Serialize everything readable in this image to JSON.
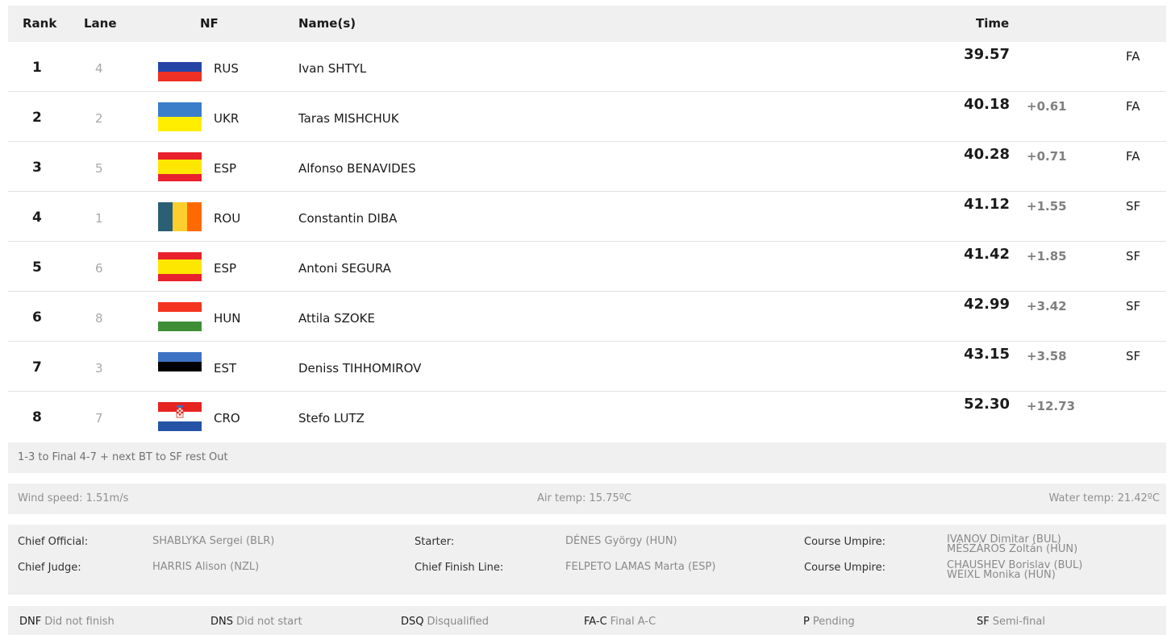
{
  "table": {
    "headers": {
      "rank": "Rank",
      "lane": "Lane",
      "nf": "NF",
      "names": "Name(s)",
      "time": "Time"
    },
    "rows": [
      {
        "rank": "1",
        "lane": "4",
        "nf": "RUS",
        "name": "Ivan SHTYL",
        "time": "39.57",
        "diff": "",
        "qual": "FA",
        "flag": "rus-flag"
      },
      {
        "rank": "2",
        "lane": "2",
        "nf": "UKR",
        "name": "Taras MISHCHUK",
        "time": "40.18",
        "diff": "+0.61",
        "qual": "FA",
        "flag": "ukr-flag"
      },
      {
        "rank": "3",
        "lane": "5",
        "nf": "ESP",
        "name": "Alfonso BENAVIDES",
        "time": "40.28",
        "diff": "+0.71",
        "qual": "FA",
        "flag": "esp-flag"
      },
      {
        "rank": "4",
        "lane": "1",
        "nf": "ROU",
        "name": "Constantin DIBA",
        "time": "41.12",
        "diff": "+1.55",
        "qual": "SF",
        "flag": "rou-flag"
      },
      {
        "rank": "5",
        "lane": "6",
        "nf": "ESP",
        "name": "Antoni SEGURA",
        "time": "41.42",
        "diff": "+1.85",
        "qual": "SF",
        "flag": "esp-flag"
      },
      {
        "rank": "6",
        "lane": "8",
        "nf": "HUN",
        "name": "Attila SZOKE",
        "time": "42.99",
        "diff": "+3.42",
        "qual": "SF",
        "flag": "hun-flag"
      },
      {
        "rank": "7",
        "lane": "3",
        "nf": "EST",
        "name": "Deniss TIHHOMIROV",
        "time": "43.15",
        "diff": "+3.58",
        "qual": "SF",
        "flag": "est-flag"
      },
      {
        "rank": "8",
        "lane": "7",
        "nf": "CRO",
        "name": "Stefo LUTZ",
        "time": "52.30",
        "diff": "+12.73",
        "qual": "",
        "flag": "cro-flag"
      }
    ]
  },
  "note": "1-3 to Final 4-7 + next BT to SF rest Out",
  "weather": {
    "wind": "Wind speed: 1.51m/s",
    "air": "Air temp: 15.75ºC",
    "water": "Water temp: 21.42ºC"
  },
  "officials": {
    "chief_official_label": "Chief Official:",
    "chief_official_value": "SHABLYKA Sergei (BLR)",
    "chief_judge_label": "Chief Judge:",
    "chief_judge_value": "HARRIS Alison (NZL)",
    "starter_label": "Starter:",
    "starter_value": "DÉNES György (HUN)",
    "chief_finish_label": "Chief Finish Line:",
    "chief_finish_value": "FELPETO LAMAS Marta (ESP)",
    "course_umpire_label_1": "Course Umpire:",
    "course_umpire_1a": "IVANOV Dimitar (BUL)",
    "course_umpire_1b": "MÉSZÁROS Zoltán (HUN)",
    "course_umpire_label_2": "Course Umpire:",
    "course_umpire_2a": "CHAUSHEV Borislav (BUL)",
    "course_umpire_2b": "WEIXL Monika (HUN)"
  },
  "legend": [
    {
      "abbr": "DNF",
      "desc": "Did not finish"
    },
    {
      "abbr": "DNS",
      "desc": "Did not start"
    },
    {
      "abbr": "DSQ",
      "desc": "Disqualified"
    },
    {
      "abbr": "FA-C",
      "desc": "Final A-C"
    },
    {
      "abbr": "P",
      "desc": "Pending"
    },
    {
      "abbr": "SF",
      "desc": "Semi-final"
    }
  ],
  "colors": {
    "header_bg": "#f0f0f0",
    "diff_text": "#808080",
    "lane_text": "#a8a8a8"
  }
}
